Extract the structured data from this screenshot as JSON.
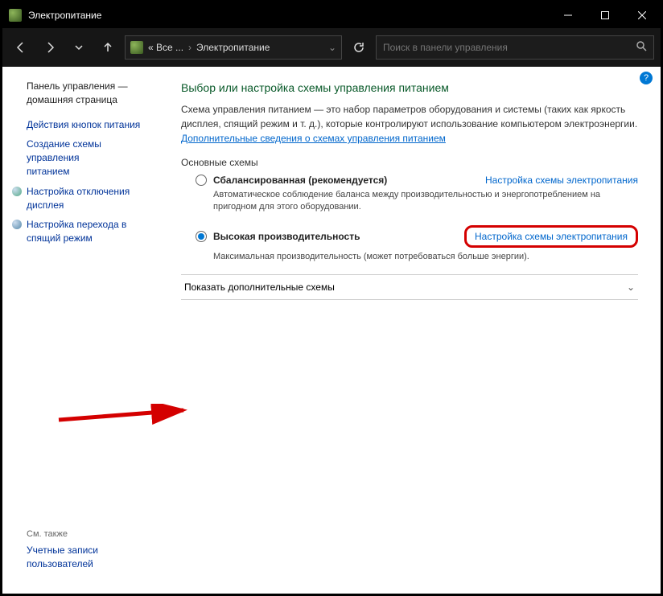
{
  "title": "Электропитание",
  "breadcrumb": {
    "root": "« Все ...",
    "current": "Электропитание"
  },
  "search_placeholder": "Поиск в панели управления",
  "sidebar": {
    "home1": "Панель управления —",
    "home2": "домашняя страница",
    "item1": "Действия кнопок питания",
    "item2a": "Создание схемы управления",
    "item2b": "питанием",
    "item3a": "Настройка отключения",
    "item3b": "дисплея",
    "item4a": "Настройка перехода в",
    "item4b": "спящий режим",
    "also": "См. также",
    "accounts1": "Учетные записи",
    "accounts2": "пользователей"
  },
  "main": {
    "heading": "Выбор или настройка схемы управления питанием",
    "desc_pre": "Схема управления питанием — это набор параметров оборудования и системы (таких как яркость дисплея, спящий режим и т. д.), которые контролируют использование компьютером электроэнергии. ",
    "desc_link": "Дополнительные сведения о схемах управления питанием",
    "section": "Основные схемы",
    "plan1": {
      "name": "Сбалансированная (рекомендуется)",
      "link": "Настройка схемы электропитания",
      "desc": "Автоматическое соблюдение баланса между производительностью и энергопотреблением на пригодном для этого оборудовании."
    },
    "plan2": {
      "name": "Высокая производительность",
      "link": "Настройка схемы электропитания",
      "desc": "Максимальная производительность (может потребоваться больше энергии)."
    },
    "expander": "Показать дополнительные схемы"
  }
}
